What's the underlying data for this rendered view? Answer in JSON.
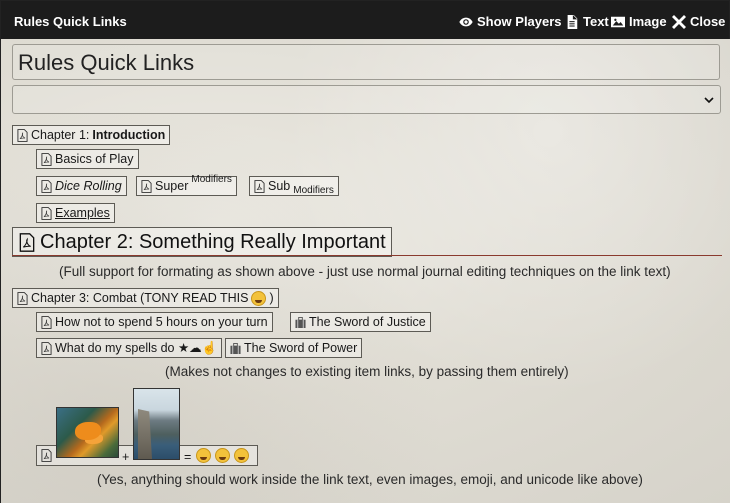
{
  "window": {
    "title": "Rules Quick Links",
    "buttons": {
      "show_players": "Show Players",
      "text": "Text",
      "image": "Image",
      "close": "Close"
    }
  },
  "journal": {
    "title_value": "Rules Quick Links",
    "select_value": ""
  },
  "links": {
    "chapter1": {
      "prefix": "Chapter 1: ",
      "bold": "Introduction"
    },
    "basics": "Basics of Play",
    "dice_rolling": "Dice Rolling",
    "super": {
      "text": "Super",
      "sup": "Modifiers"
    },
    "sub": {
      "text": "Sub",
      "sub": "Modifiers"
    },
    "examples": "Examples",
    "chapter2": "Chapter 2: Something Really Important",
    "chapter3": "Chapter 3: Combat (TONY READ THIS ",
    "chapter3_end": ")",
    "spend": "How not to spend 5 hours on your turn",
    "sword_justice": "The Sword of Justice",
    "spells": "What do my spells do ★☁☝",
    "sword_power": "The Sword of Power",
    "images_plus": "+",
    "images_equals": "="
  },
  "notes": {
    "formatting": "(Full support for formating as shown above - just use normal journal editing techniques on the link text)",
    "items": "(Makes not changes to existing item links, by passing them entirely)",
    "anything": "(Yes, anything should work inside the link text, even images, emoji, and unicode like above)"
  },
  "colors": {
    "titlebar": "#1c1c1c",
    "rule": "#8a3a2e",
    "parchment": "#e6e2d8"
  }
}
